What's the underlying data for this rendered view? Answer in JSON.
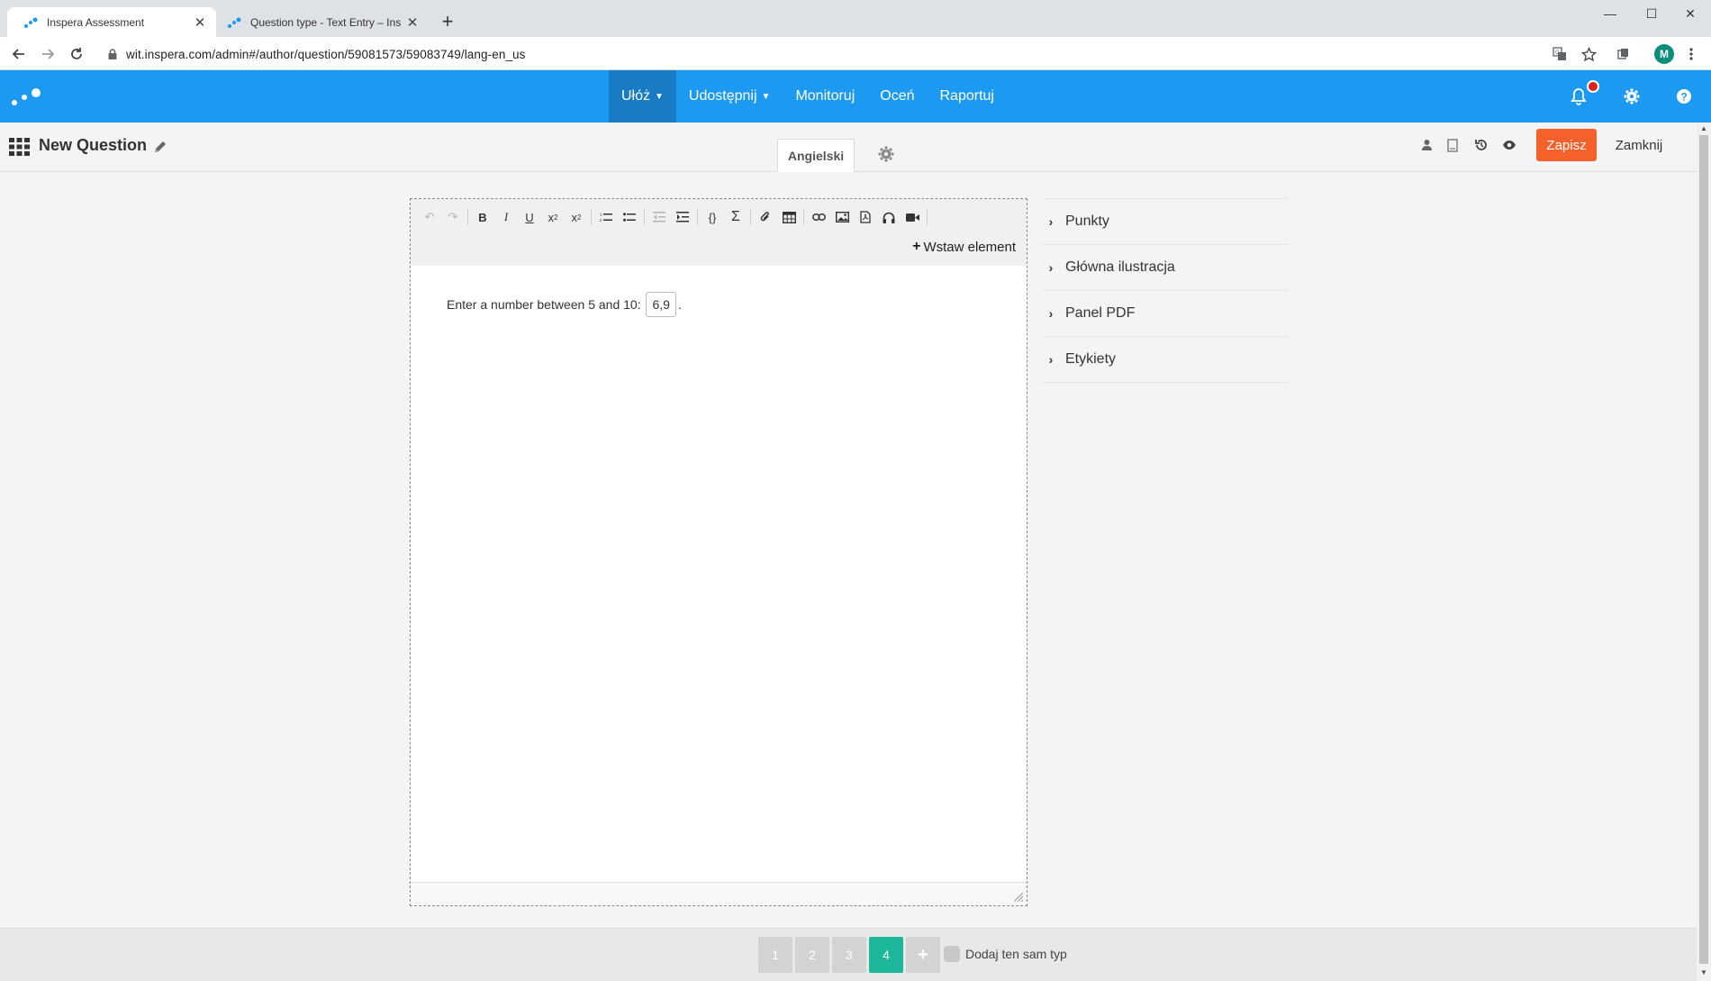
{
  "browser": {
    "tabs": [
      {
        "title": "Inspera Assessment",
        "active": true
      },
      {
        "title": "Question type - Text Entry – Insp",
        "active": false
      }
    ],
    "url": "wit.inspera.com/admin#/author/question/59081573/59083749/lang-en_us",
    "profile_initial": "M"
  },
  "app": {
    "accent": "#1c9af2",
    "nav": [
      {
        "label": "Ułóż",
        "dropdown": true,
        "active": true
      },
      {
        "label": "Udostępnij",
        "dropdown": true,
        "active": false
      },
      {
        "label": "Monitoruj",
        "dropdown": false,
        "active": false
      },
      {
        "label": "Oceń",
        "dropdown": false,
        "active": false
      },
      {
        "label": "Raportuj",
        "dropdown": false,
        "active": false
      }
    ]
  },
  "question": {
    "title": "New Question",
    "language_tab": "Angielski",
    "save_label": "Zapisz",
    "close_label": "Zamknij"
  },
  "editor": {
    "insert_label": "Wstaw element",
    "text_before": "Enter a number between 5 and 10:",
    "answer_value": "6,9",
    "text_after": "."
  },
  "panels": [
    "Punkty",
    "Główna ilustracja",
    "Panel PDF",
    "Etykiety"
  ],
  "footer": {
    "pages": [
      "1",
      "2",
      "3",
      "4"
    ],
    "active_page": "4",
    "add_same_type_label": "Dodaj ten sam typ"
  }
}
